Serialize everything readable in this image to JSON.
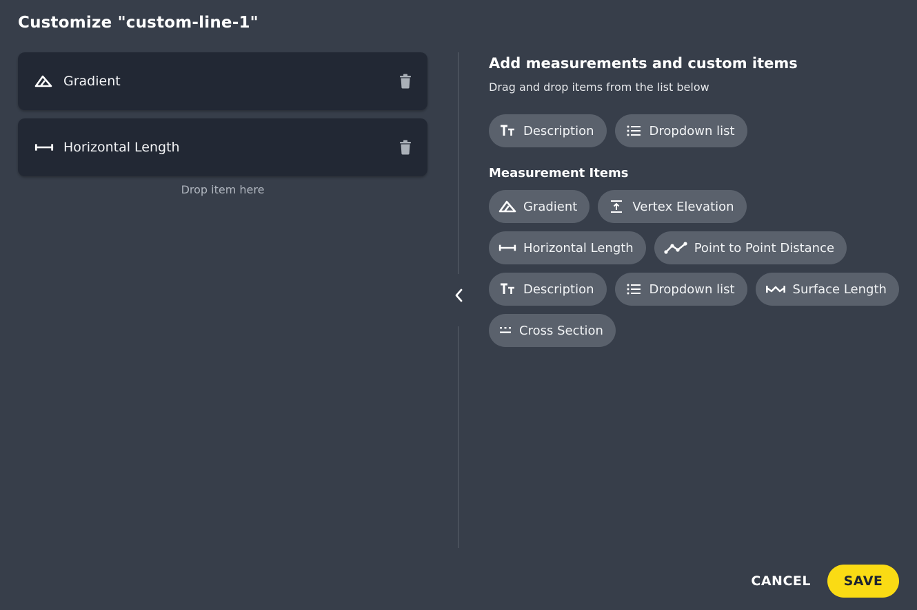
{
  "dialog": {
    "title": "Customize \"custom-line-1\""
  },
  "selected": {
    "items": [
      {
        "label": "Gradient",
        "icon": "gradient-icon"
      },
      {
        "label": "Horizontal Length",
        "icon": "horizontal-length-icon"
      }
    ],
    "drop_hint": "Drop item here"
  },
  "library": {
    "heading": "Add measurements and custom items",
    "subheading": "Drag and drop items from the list below",
    "custom_items": [
      {
        "label": "Description",
        "icon": "text-icon"
      },
      {
        "label": "Dropdown list",
        "icon": "list-icon"
      }
    ],
    "measurement_heading": "Measurement Items",
    "measurement_items": [
      {
        "label": "Gradient",
        "icon": "gradient-icon"
      },
      {
        "label": "Vertex Elevation",
        "icon": "vertex-elevation-icon"
      },
      {
        "label": "Horizontal Length",
        "icon": "horizontal-length-icon"
      },
      {
        "label": "Point to Point Distance",
        "icon": "point-to-point-icon"
      },
      {
        "label": "Description",
        "icon": "text-icon"
      },
      {
        "label": "Dropdown list",
        "icon": "list-icon"
      },
      {
        "label": "Surface Length",
        "icon": "surface-length-icon"
      },
      {
        "label": "Cross Section",
        "icon": "cross-section-icon"
      }
    ]
  },
  "footer": {
    "cancel_label": "CANCEL",
    "save_label": "SAVE"
  },
  "colors": {
    "background": "#373e4a",
    "card": "#222834",
    "chip": "#5a616c",
    "accent": "#fadb14"
  }
}
